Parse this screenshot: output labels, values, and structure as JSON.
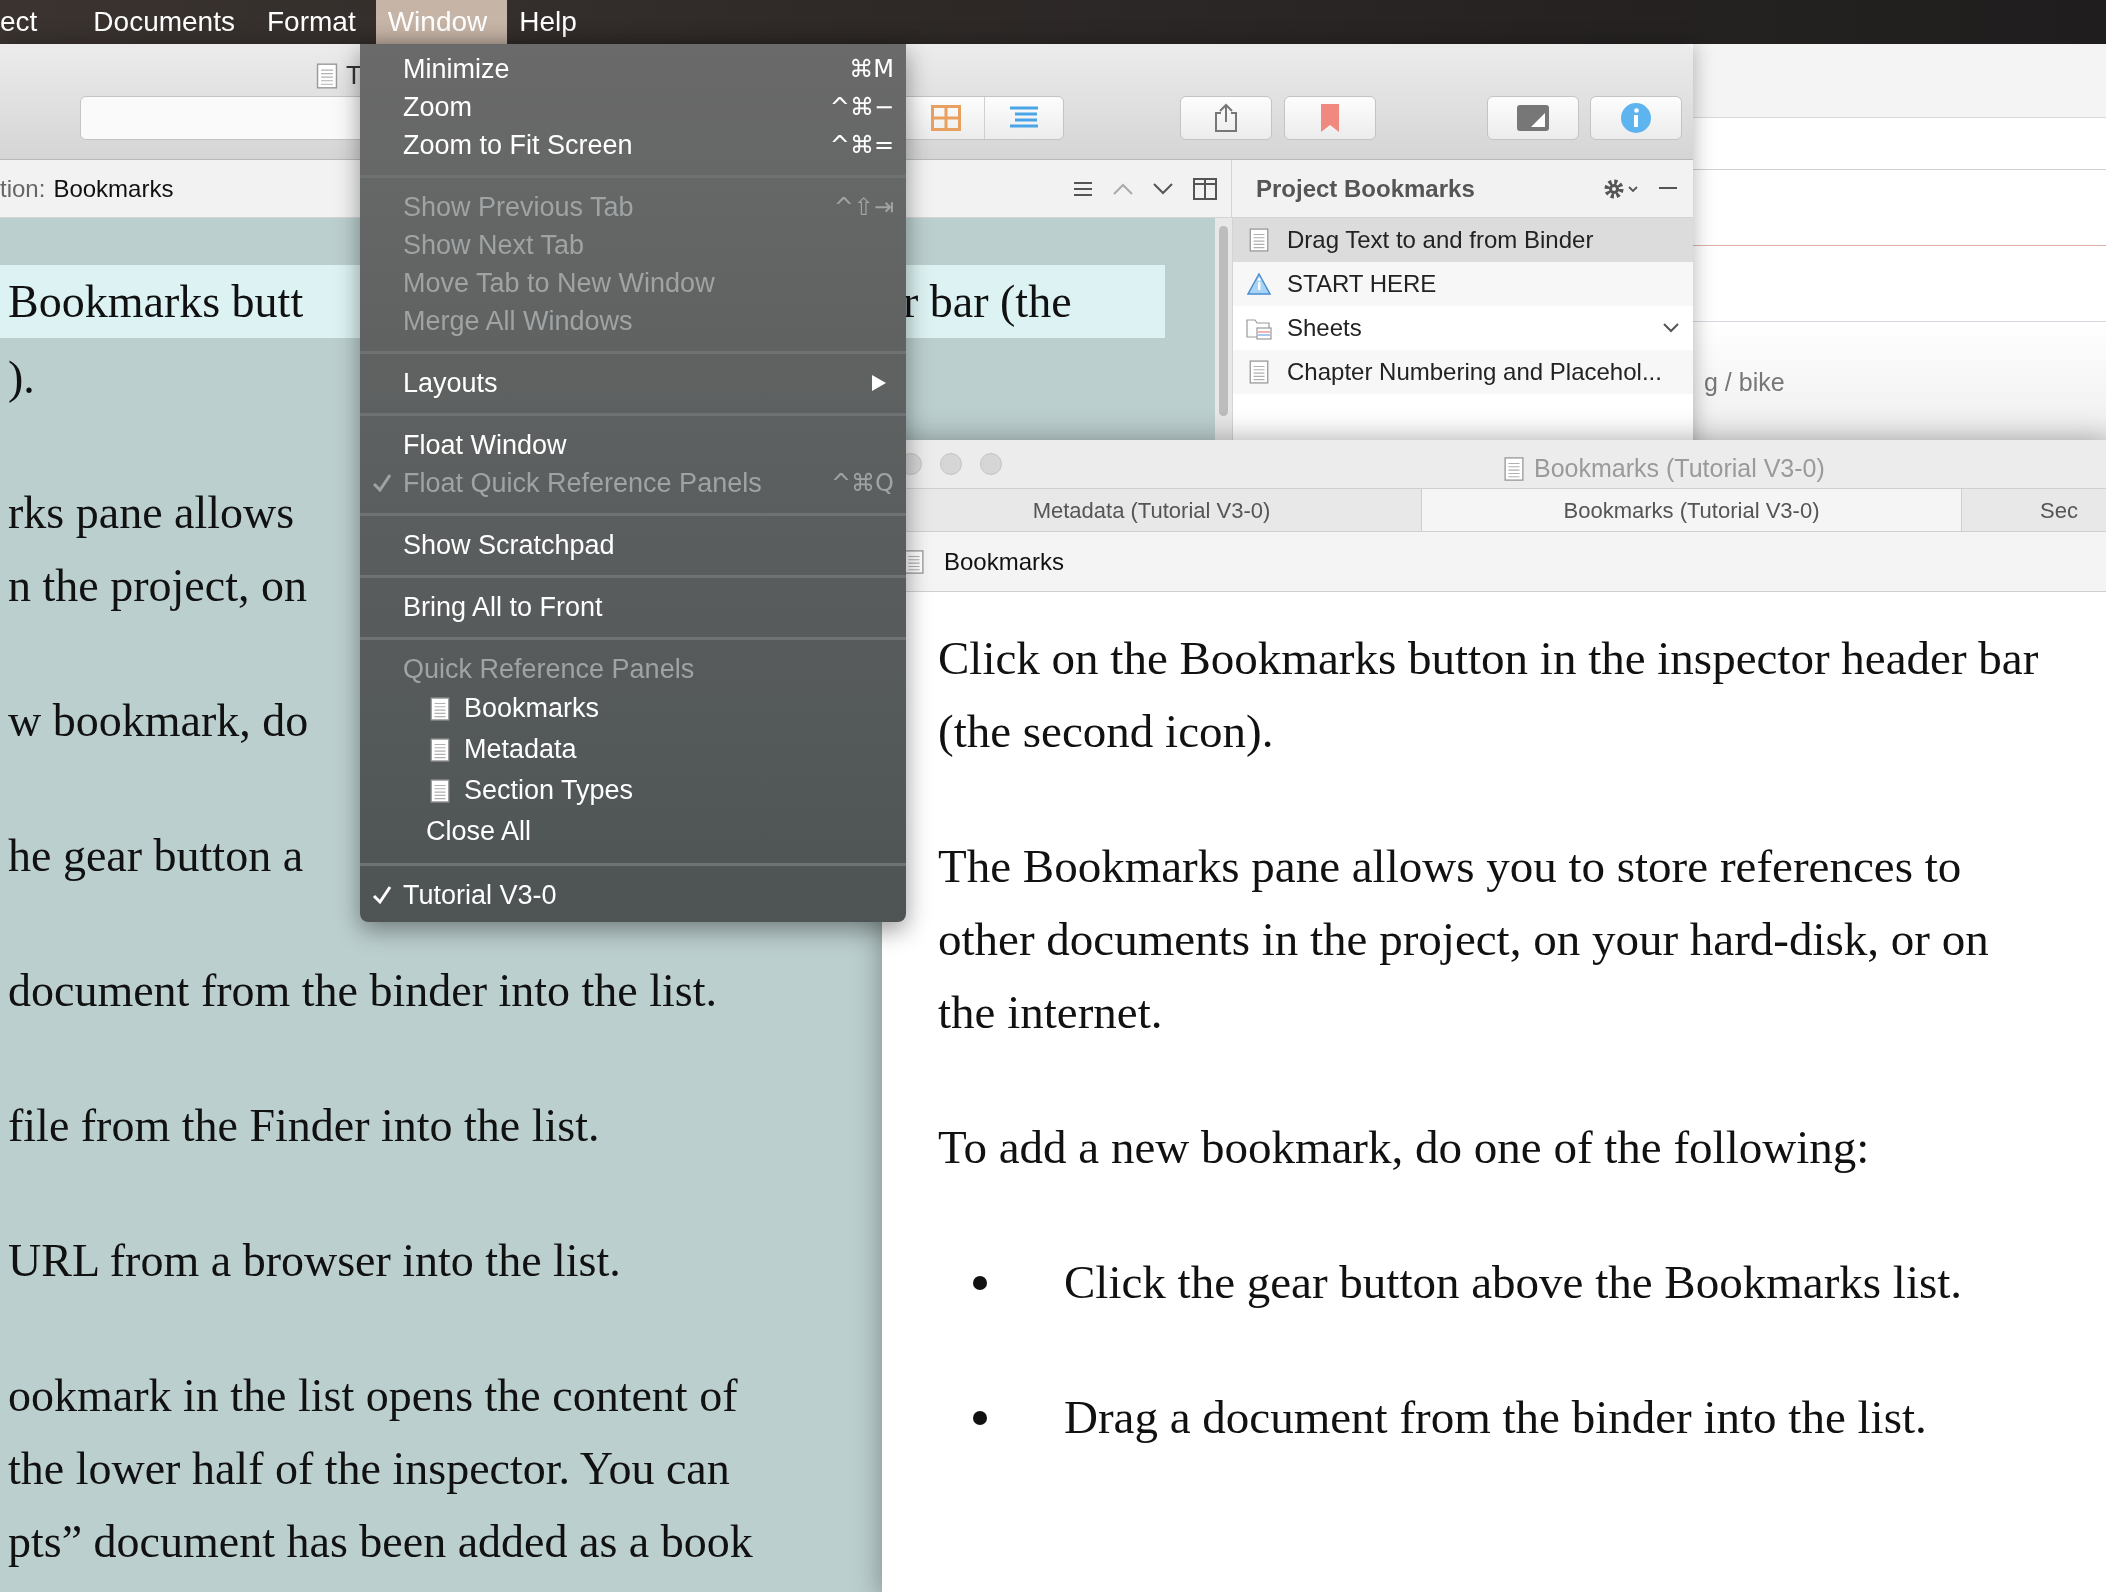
{
  "menu_bar": {
    "items": [
      {
        "label": "ect",
        "selected": false
      },
      {
        "label": "Documents",
        "selected": false
      },
      {
        "label": "Format",
        "selected": false
      },
      {
        "label": "Window",
        "selected": true
      },
      {
        "label": "Help",
        "selected": false
      }
    ]
  },
  "window_menu": {
    "items": [
      {
        "kind": "item",
        "label": "Minimize",
        "shortcut": "⌘M",
        "disabled": false,
        "checked": false
      },
      {
        "kind": "item",
        "label": "Zoom",
        "shortcut": "^⌘−",
        "disabled": false,
        "checked": false
      },
      {
        "kind": "item",
        "label": "Zoom to Fit Screen",
        "shortcut": "^⌘=",
        "disabled": false,
        "checked": false
      },
      {
        "kind": "separator"
      },
      {
        "kind": "item",
        "label": "Show Previous Tab",
        "shortcut": "^⇧⇥",
        "disabled": true,
        "checked": false
      },
      {
        "kind": "item",
        "label": "Show Next Tab",
        "disabled": true,
        "checked": false
      },
      {
        "kind": "item",
        "label": "Move Tab to New Window",
        "disabled": true,
        "checked": false
      },
      {
        "kind": "item",
        "label": "Merge All Windows",
        "disabled": true,
        "checked": false
      },
      {
        "kind": "separator"
      },
      {
        "kind": "submenu",
        "label": "Layouts",
        "disabled": false
      },
      {
        "kind": "separator"
      },
      {
        "kind": "item",
        "label": "Float Window",
        "disabled": false,
        "checked": false
      },
      {
        "kind": "item",
        "label": "Float Quick Reference Panels",
        "shortcut": "^⌘Q",
        "disabled": true,
        "checked": true
      },
      {
        "kind": "separator"
      },
      {
        "kind": "item",
        "label": "Show Scratchpad",
        "disabled": false,
        "checked": false
      },
      {
        "kind": "separator"
      },
      {
        "kind": "item",
        "label": "Bring All to Front",
        "disabled": false,
        "checked": false
      },
      {
        "kind": "separator"
      },
      {
        "kind": "header",
        "label": "Quick Reference Panels",
        "disabled": true
      },
      {
        "kind": "panel",
        "label": "Bookmarks",
        "disabled": false
      },
      {
        "kind": "panel",
        "label": "Metadata",
        "disabled": false
      },
      {
        "kind": "panel",
        "label": "Section Types",
        "disabled": false
      },
      {
        "kind": "indented",
        "label": "Close All",
        "disabled": false
      },
      {
        "kind": "separator"
      },
      {
        "kind": "item",
        "label": "Tutorial V3-0",
        "disabled": false,
        "checked": true
      }
    ]
  },
  "main_window": {
    "title": "T",
    "header_prefix": "tion:",
    "header_label": "Bookmarks",
    "editor": {
      "paragraphs": [
        {
          "lines": [
            {
              "left": "Bookmarks butt",
              "right": "r bar (the",
              "highlighted": true
            },
            {
              "left": ").",
              "highlighted": false
            }
          ]
        },
        {
          "lines": [
            {
              "left": "rks pane allows",
              "highlighted": false
            },
            {
              "left": "n the project, on",
              "highlighted": false
            }
          ]
        },
        {
          "lines": [
            {
              "left": "w bookmark, do",
              "highlighted": false
            }
          ]
        },
        {
          "lines": [
            {
              "left": "he gear button a",
              "highlighted": false
            }
          ]
        },
        {
          "lines": [
            {
              "left": "document from the binder into the list.",
              "highlighted": false
            }
          ]
        },
        {
          "lines": [
            {
              "left": "file from the Finder into the list.",
              "highlighted": false
            }
          ]
        },
        {
          "lines": [
            {
              "left": "URL from a browser into the list.",
              "highlighted": false
            }
          ]
        },
        {
          "lines": [
            {
              "left": "ookmark in the list opens the content of",
              "highlighted": false
            },
            {
              "left": "the lower half of the inspector. You can",
              "highlighted": false
            },
            {
              "left": "pts” document has been added as a book",
              "highlighted": false
            }
          ]
        }
      ]
    }
  },
  "inspector": {
    "title": "Project Bookmarks",
    "bookmarks": [
      {
        "label": "Drag Text to and from Binder",
        "kind": "document",
        "selected": true,
        "has_children": false
      },
      {
        "label": "START HERE",
        "kind": "warning",
        "selected": false,
        "has_children": false
      },
      {
        "label": "Sheets",
        "kind": "folder",
        "selected": false,
        "has_children": true
      },
      {
        "label": "Chapter Numbering and Placehol...",
        "kind": "document",
        "selected": false,
        "has_children": false
      }
    ]
  },
  "background_window": {
    "text": "g / bike"
  },
  "quick_reference_window": {
    "title": "Bookmarks (Tutorial V3-0)",
    "tabs": [
      {
        "label": "Metadata (Tutorial V3-0)",
        "selected": false
      },
      {
        "label": "Bookmarks (Tutorial V3-0)",
        "selected": true
      },
      {
        "label": "Sec",
        "selected": false
      }
    ],
    "header": "Bookmarks",
    "paragraphs": [
      "Click on the Bookmarks button in the inspector header bar (the second icon).",
      "The Bookmarks pane allows you to store references to other documents in the project, on your hard-disk, or on the internet.",
      "To add a new bookmark, do one of the following:"
    ],
    "bullets": [
      "Click the gear button above the Bookmarks list.",
      "Drag a document from the binder into the list."
    ]
  }
}
